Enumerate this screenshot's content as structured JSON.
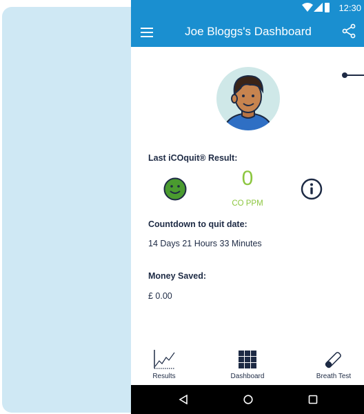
{
  "status_bar": {
    "time": "12:30"
  },
  "app_bar": {
    "title": "Joe Bloggs's Dashboard"
  },
  "last_result": {
    "label": "Last iCOquit® Result:",
    "value": "0",
    "unit": "CO PPM"
  },
  "countdown": {
    "label": "Countdown to quit date:",
    "value": "14 Days 21 Hours 33 Minutes"
  },
  "money": {
    "label": "Money Saved:",
    "value": "£ 0.00"
  },
  "tabs": [
    {
      "label": "Results",
      "icon": "results-chart-icon"
    },
    {
      "label": "Dashboard",
      "icon": "grid-icon"
    },
    {
      "label": "Breath Test",
      "icon": "breath-tester-icon"
    }
  ],
  "colors": {
    "primary": "#1a8fd0",
    "accent_green": "#8cc63f",
    "text_dark": "#1d2a44",
    "background_panel": "#cfe8f4"
  }
}
